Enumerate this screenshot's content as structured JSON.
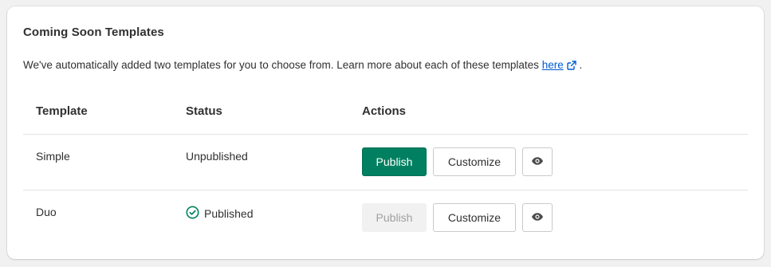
{
  "card": {
    "title": "Coming Soon Templates",
    "description_prefix": "We've automatically added two templates for you to choose from. Learn more about each of these templates ",
    "link_text": "here",
    "description_suffix": " ."
  },
  "table": {
    "headers": {
      "template": "Template",
      "status": "Status",
      "actions": "Actions"
    },
    "rows": [
      {
        "template": "Simple",
        "status": "Unpublished",
        "published": false,
        "publish_label": "Publish",
        "customize_label": "Customize"
      },
      {
        "template": "Duo",
        "status": "Published",
        "published": true,
        "publish_label": "Publish",
        "customize_label": "Customize"
      }
    ]
  },
  "icons": {
    "link": "external-link-icon",
    "status_published": "check-circle-icon",
    "preview": "eye-icon"
  },
  "colors": {
    "primary": "#008060",
    "link": "#005bd3",
    "success": "#008060"
  }
}
